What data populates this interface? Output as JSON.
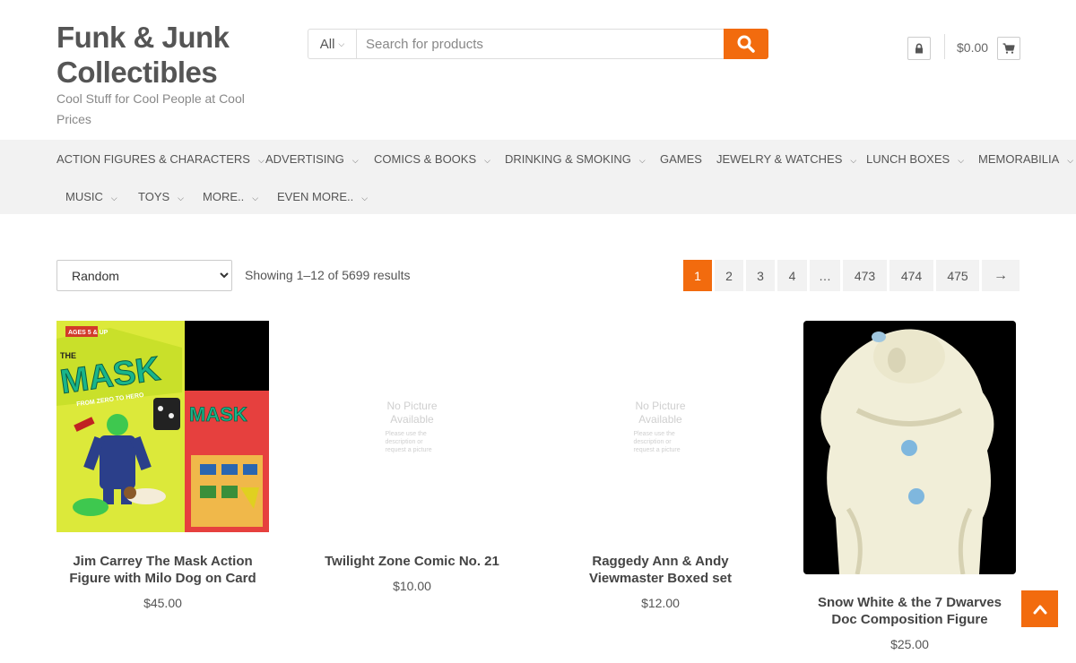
{
  "site": {
    "title": "Funk & Junk Collectibles",
    "tagline": "Cool Stuff for Cool People at Cool Prices"
  },
  "search": {
    "category": "All",
    "placeholder": "Search for products"
  },
  "header": {
    "cart_total": "$0.00"
  },
  "nav": {
    "items": [
      "ACTION FIGURES & CHARACTERS",
      "ADVERTISING",
      "COMICS & BOOKS",
      "DRINKING & SMOKING",
      "GAMES",
      "JEWELRY & WATCHES",
      "LUNCH BOXES",
      "MEMORABILIA",
      "MUSIC",
      "TOYS",
      "MORE..",
      "EVEN MORE.."
    ]
  },
  "shop": {
    "orderby_selected": "Random",
    "result_count": "Showing 1–12 of 5699 results",
    "pagination": [
      "1",
      "2",
      "3",
      "4",
      "…",
      "473",
      "474",
      "475",
      "→"
    ],
    "current_page": "1"
  },
  "products": [
    {
      "title": "Jim Carrey The Mask Action Figure with Milo Dog on Card",
      "price": "$45.00",
      "image": "mask-figure-card",
      "image_text": [
        "THE",
        "MASK",
        "FROM ZERO TO HERO",
        "AGES 5 & UP"
      ]
    },
    {
      "title": "Twilight Zone Comic No. 21",
      "price": "$10.00",
      "image": "no-picture",
      "image_text": [
        "No Picture",
        "Available",
        "Please use the description or request a picture"
      ]
    },
    {
      "title": "Raggedy Ann & Andy Viewmaster Boxed set",
      "price": "$12.00",
      "image": "no-picture",
      "image_text": [
        "No Picture",
        "Available",
        "Please use the description or request a picture"
      ]
    },
    {
      "title": "Snow White & the 7 Dwarves Doc Composition Figure",
      "price": "$25.00",
      "image": "doc-figure"
    }
  ],
  "colors": {
    "accent": "#f26b0e",
    "nav_bg": "#f2f2f2",
    "text": "#555555"
  },
  "icons": [
    "search-icon",
    "lock-icon",
    "cart-icon",
    "chevron-down-icon",
    "arrow-up-icon"
  ]
}
